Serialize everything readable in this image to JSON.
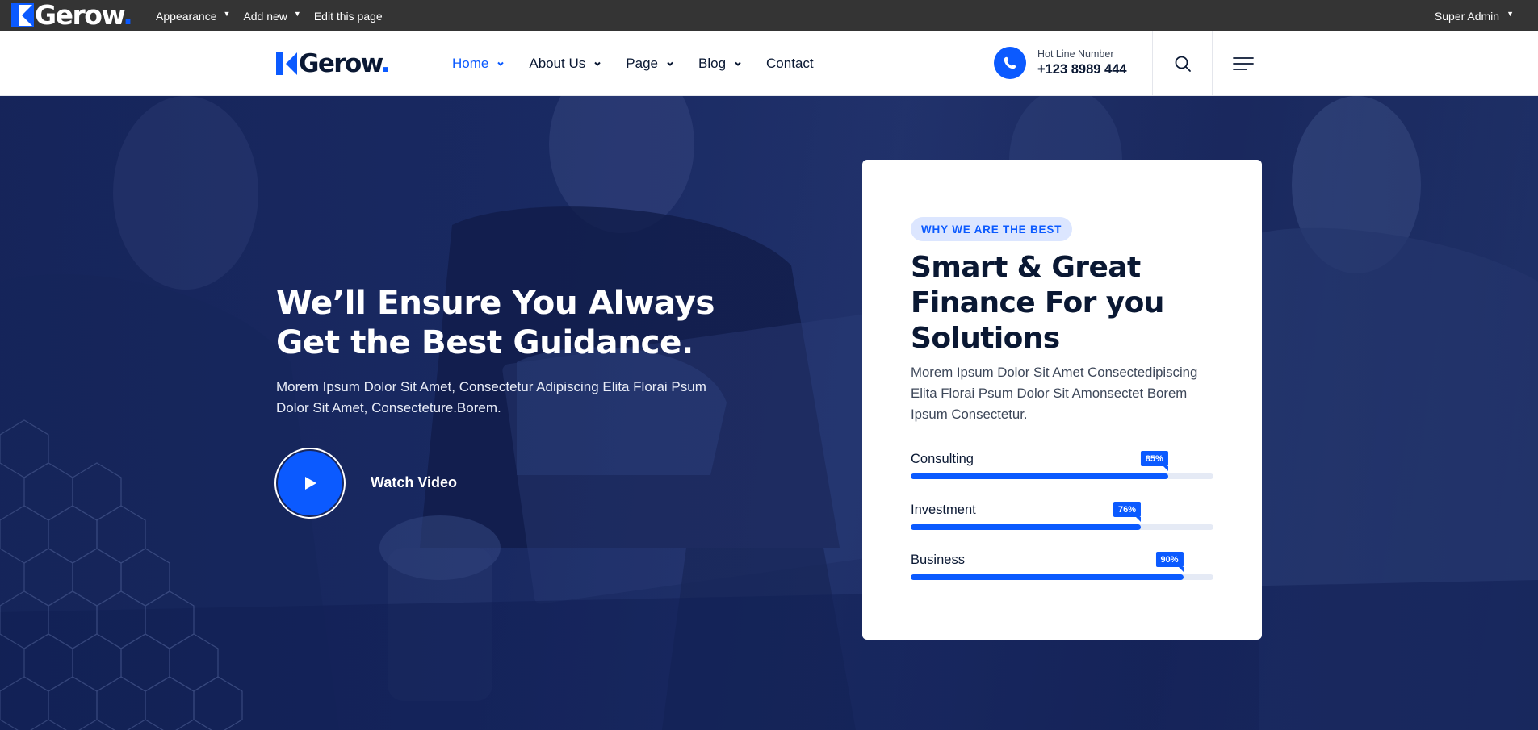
{
  "adminbar": {
    "logo_text": "Gerow",
    "logo_dot": ".",
    "menu": [
      {
        "label": "Appearance",
        "has_dropdown": true
      },
      {
        "label": "Add new",
        "has_dropdown": true
      },
      {
        "label": "Edit this page",
        "has_dropdown": false
      }
    ],
    "user": "Super Admin"
  },
  "header": {
    "logo_text": "Gerow",
    "logo_dot": ".",
    "nav": [
      {
        "label": "Home",
        "active": true,
        "has_dropdown": true
      },
      {
        "label": "About Us",
        "active": false,
        "has_dropdown": true
      },
      {
        "label": "Page",
        "active": false,
        "has_dropdown": true
      },
      {
        "label": "Blog",
        "active": false,
        "has_dropdown": true
      },
      {
        "label": "Contact",
        "active": false,
        "has_dropdown": false
      }
    ],
    "hotline": {
      "label": "Hot Line Number",
      "number": "+123 8989 444",
      "icon": "phone-icon"
    },
    "icons": [
      "search-icon",
      "menu-icon"
    ]
  },
  "hero": {
    "title": "We’ll Ensure You Always Get the Best Guidance.",
    "description": "Morem Ipsum Dolor Sit Amet, Consectetur Adipiscing Elita Florai Psum Dolor Sit Amet, Consecteture.Borem.",
    "video_label": "Watch Video"
  },
  "card": {
    "badge": "WHY WE ARE THE BEST",
    "title": "Smart & Great Finance For you Solutions",
    "description": "Morem Ipsum Dolor Sit Amet Consectedipiscing Elita Florai Psum Dolor Sit Amonsectet Borem Ipsum Consectetur.",
    "skills": [
      {
        "name": "Consulting",
        "percent": 85,
        "label": "85%"
      },
      {
        "name": "Investment",
        "percent": 76,
        "label": "76%"
      },
      {
        "name": "Business",
        "percent": 90,
        "label": "90%"
      }
    ]
  },
  "colors": {
    "brand_blue": "#0b5aff",
    "dark_navy": "#0a1833",
    "admin_bar": "#343434",
    "hero_overlay": "#1b2c66",
    "badge_bg": "#dce6ff"
  }
}
